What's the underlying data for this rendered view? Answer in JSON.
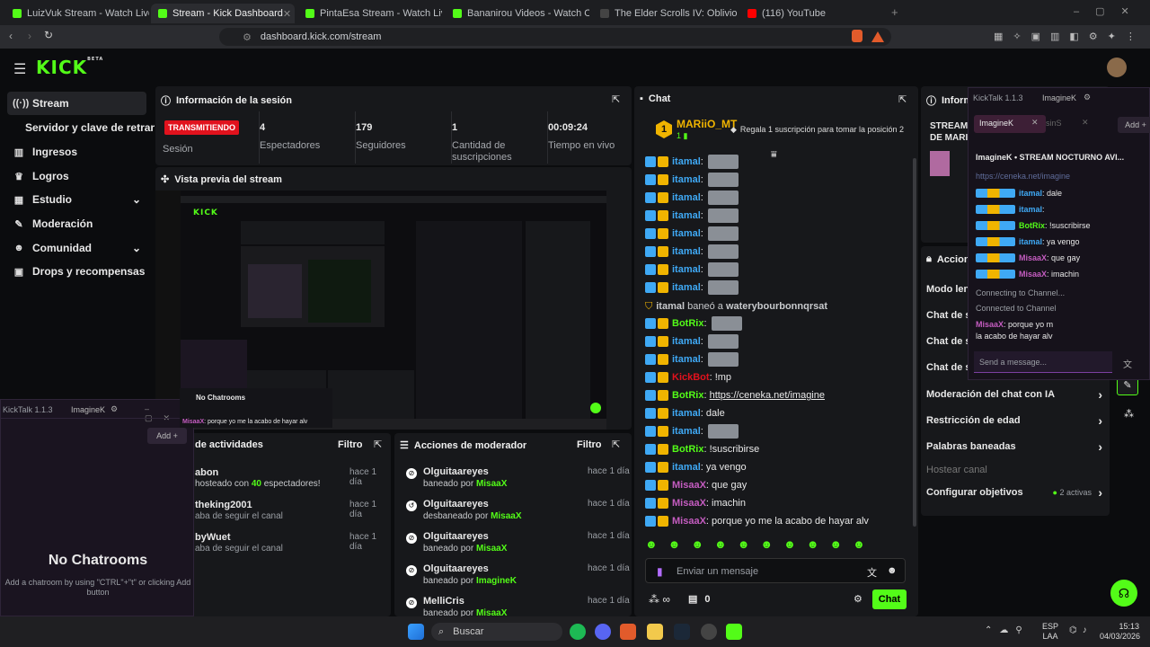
{
  "browser": {
    "tabs": [
      {
        "title": "LuizVuk Stream - Watch Live on Kick"
      },
      {
        "title": "Stream - Kick Dashboard"
      },
      {
        "title": "PintaEsa Stream - Watch Live on Kick"
      },
      {
        "title": "Bananirou Videos - Watch On-Deman"
      },
      {
        "title": "The Elder Scrolls IV: Oblivion Remaste"
      },
      {
        "title": "(116) YouTube"
      }
    ],
    "url": "dashboard.kick.com/stream"
  },
  "app": {
    "logo": "KICK",
    "logo_sup": "BETA"
  },
  "sidebar": {
    "items": [
      {
        "label": "Stream",
        "icon": "stream-icon"
      },
      {
        "label": "Servidor y clave de retransmisión"
      },
      {
        "label": "Ingresos",
        "icon": "chart-icon"
      },
      {
        "label": "Logros",
        "icon": "trophy-icon"
      },
      {
        "label": "Estudio",
        "icon": "grid-icon"
      },
      {
        "label": "Moderación",
        "icon": "wrench-icon"
      },
      {
        "label": "Comunidad",
        "icon": "users-icon"
      },
      {
        "label": "Drops y recompensas",
        "icon": "gift-icon"
      }
    ]
  },
  "session": {
    "title": "Información de la sesión",
    "live_badge": "TRANSMITIENDO",
    "session_label": "Sesión",
    "stats": [
      {
        "value": "4",
        "label": "Espectadores"
      },
      {
        "value": "179",
        "label": "Seguidores"
      },
      {
        "value": "1",
        "label": "Cantidad de suscripciones"
      },
      {
        "value": "00:09:24",
        "label": "Tiempo en vivo"
      }
    ]
  },
  "preview": {
    "title": "Vista previa del stream"
  },
  "activity": {
    "title": "de actividades",
    "filter": "Filtro",
    "items": [
      {
        "name": "abon",
        "desc": "hosteado con",
        "count": "40",
        "desc2": "espectadores!",
        "time": "hace 1 día"
      },
      {
        "name": "theking2001",
        "desc": "aba de seguir el canal",
        "time": "hace 1 día"
      },
      {
        "name": "byWuet",
        "desc": "aba de seguir el canal",
        "time": "hace 1 día"
      }
    ]
  },
  "modactions": {
    "title": "Acciones de moderador",
    "filter": "Filtro",
    "items": [
      {
        "user": "Olguitaareyes",
        "action": "baneado por",
        "by": "MisaaX",
        "time": "hace 1 día"
      },
      {
        "user": "Olguitaareyes",
        "action": "desbaneado por",
        "by": "MisaaX",
        "time": "hace 1 día"
      },
      {
        "user": "Olguitaareyes",
        "action": "baneado por",
        "by": "MisaaX",
        "time": "hace 1 día"
      },
      {
        "user": "Olguitaareyes",
        "action": "baneado por",
        "by": "ImagineK",
        "time": "hace 1 día"
      },
      {
        "user": "MelliCris",
        "action": "baneado por",
        "by": "MisaaX",
        "time": "hace 1 día"
      }
    ]
  },
  "chat": {
    "title": "Chat",
    "pinned_user": "MARiiO_MT",
    "pinned_rank": "1",
    "pinned_sub": "1",
    "sub_prompt": "Regala 1 suscripción para tomar la posición 2",
    "ban_notice": {
      "by": "itamal",
      "verb": "baneó a",
      "target": "waterybourbonnqrsat"
    },
    "messages": [
      {
        "user": "itamal",
        "text": "",
        "emote": true
      },
      {
        "user": "itamal",
        "text": "",
        "emote": true
      },
      {
        "user": "itamal",
        "text": "",
        "emote": true
      },
      {
        "user": "itamal",
        "text": "",
        "emote": true
      },
      {
        "user": "itamal",
        "text": "",
        "emote": true
      },
      {
        "user": "itamal",
        "text": "",
        "emote": true
      },
      {
        "user": "itamal",
        "text": "",
        "emote": true
      },
      {
        "user": "itamal",
        "text": "",
        "emote": true
      },
      {
        "user": "BotRix",
        "text": "",
        "emote": true
      },
      {
        "user": "itamal",
        "text": "",
        "emote": true
      },
      {
        "user": "itamal",
        "text": "",
        "emote": true
      },
      {
        "user": "KickBot",
        "text": "!mp"
      },
      {
        "user": "BotRix",
        "text": "https://ceneka.net/imagine"
      },
      {
        "user": "itamal",
        "text": "dale"
      },
      {
        "user": "itamal",
        "text": "",
        "emote": true
      },
      {
        "user": "BotRix",
        "text": "!suscribirse"
      },
      {
        "user": "itamal",
        "text": "ya vengo"
      },
      {
        "user": "MisaaX",
        "text": "que gay"
      },
      {
        "user": "MisaaX",
        "text": "imachin"
      },
      {
        "user": "MisaaX",
        "text": "porque yo me la acabo de hayar alv"
      }
    ],
    "input_placeholder": "Enviar un mensaje",
    "send_label": "Chat",
    "viewer_count": "0"
  },
  "info_panel": {
    "title": "Informa",
    "stream_title_partial": "STREAM",
    "subtitle_partial": "DE MARI"
  },
  "actions_panel": {
    "title": "Accion",
    "items": [
      {
        "label": "Modo lent"
      },
      {
        "label": "Chat de so"
      },
      {
        "label": "Chat de so"
      },
      {
        "label": "Chat de so"
      },
      {
        "label": "Moderación del chat con IA"
      },
      {
        "label": "Restricción de edad"
      },
      {
        "label": "Palabras baneadas"
      },
      {
        "label": "Hostear canal"
      },
      {
        "label": "Configurar objetivos",
        "status": "2 activas"
      }
    ]
  },
  "kicktalk_float": {
    "title": "KickTalk 1.1.3",
    "tab": "ImagineK",
    "channels": [
      "ImagineK",
      "sinS"
    ],
    "add_label": "Add",
    "stream_title": "STREAM NOCTURNO AVI...",
    "link": "https://ceneka.net/imagine",
    "messages": [
      {
        "user": "itamal",
        "text": "dale"
      },
      {
        "user": "itamal",
        "text": ""
      },
      {
        "user": "BotRix",
        "text": "!suscribirse"
      },
      {
        "user": "itamal",
        "text": "ya vengo"
      },
      {
        "user": "MisaaX",
        "text": "que gay"
      },
      {
        "user": "MisaaX",
        "text": "imachin"
      }
    ],
    "status1": "Connecting to Channel...",
    "status2": "Connected to Channel",
    "last_user": "MisaaX",
    "last_text": "porque yo m",
    "last_text2": "la acabo de hayar alv",
    "input_placeholder": "Send a message..."
  },
  "kicktalk_left": {
    "title": "KickTalk 1.1.3",
    "tab": "ImagineK",
    "add_label": "Add",
    "empty_title": "No Chatrooms",
    "empty_desc": "Add a chatroom by using \"CTRL\"+\"t\" or clicking Add button"
  },
  "taskbar": {
    "search": "Buscar",
    "lang": "ESP",
    "lang2": "LAA",
    "time": "15:13",
    "date": "04/03/2026"
  },
  "colors": {
    "accent": "#53fc18",
    "live": "#e1121d",
    "bg": "#0b0c0e",
    "panel": "#17181b"
  }
}
